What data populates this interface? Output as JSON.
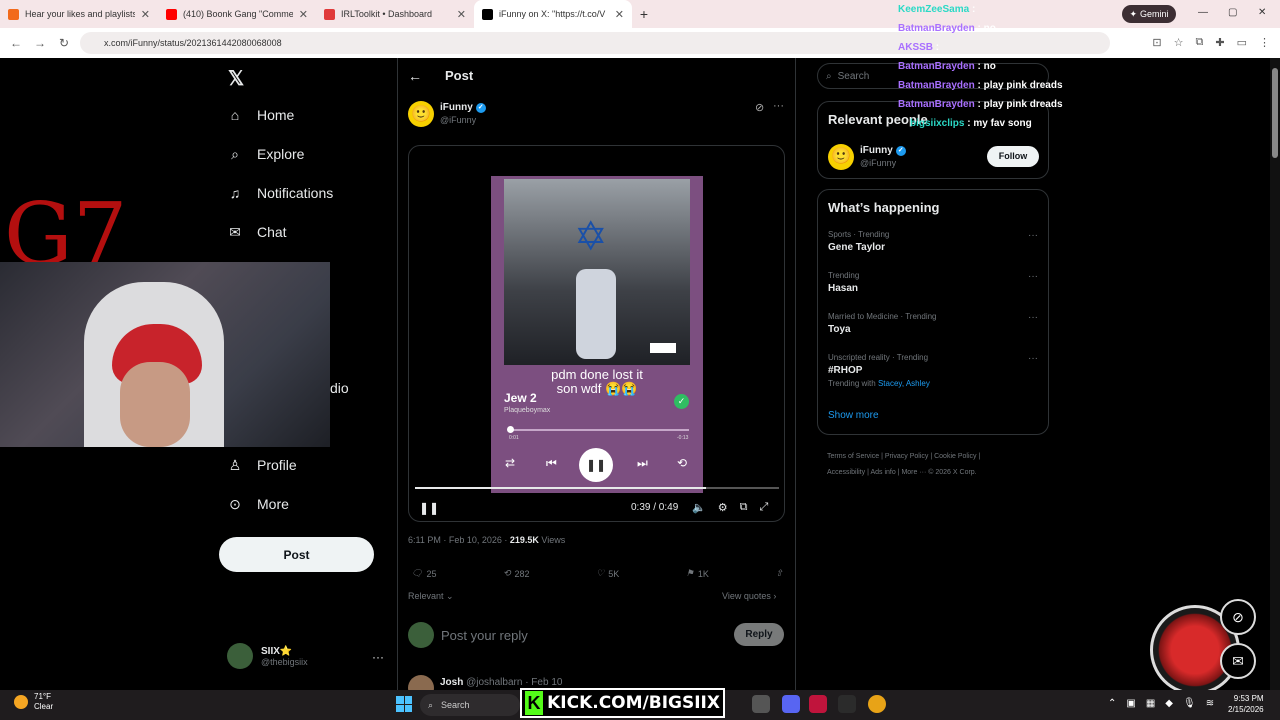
{
  "browser": {
    "tabs": [
      {
        "title": "Hear your likes and playlists, an",
        "color": "#f26a1b"
      },
      {
        "title": "(410) Boonk Gang \"Comments",
        "color": "#ff0000"
      },
      {
        "title": "IRLToolkit • Dashboard",
        "color": "#e03a3a"
      },
      {
        "title": "iFunny on X: \"https://t.co/V",
        "color": "#000000"
      }
    ],
    "url": "x.com/iFunny/status/2021361442080068008",
    "gemini_label": "Gemini"
  },
  "nav": {
    "items": [
      {
        "label": "Home",
        "icon": "home-icon"
      },
      {
        "label": "Explore",
        "icon": "search-icon"
      },
      {
        "label": "Notifications",
        "icon": "bell-icon"
      },
      {
        "label": "Chat",
        "icon": "mail-icon"
      },
      {
        "label": "Profile",
        "icon": "person-icon"
      },
      {
        "label": "More",
        "icon": "more-circle-icon"
      }
    ],
    "partial_label": "dio",
    "post_button": "Post",
    "account": {
      "name": "SIIX⭐",
      "handle": "@thebigsiix"
    }
  },
  "overlay": {
    "g7": "G7"
  },
  "post": {
    "header": "Post",
    "author": {
      "name": "iFunny",
      "handle": "@iFunny"
    },
    "video": {
      "caption_line1": "pdm done lost it",
      "caption_line2": "son wdf 😭😭",
      "song": "Jew 2",
      "artist": "Plaqueboymax",
      "elapsed_small": "0:01",
      "remaining_small": "-0:13",
      "time": "0:39 / 0:49",
      "progress": 0.8
    },
    "meta": {
      "time": "6:11 PM · Feb 10, 2026 · ",
      "views": "219.5K",
      "views_label": " Views"
    },
    "actions": {
      "replies": "25",
      "reposts": "282",
      "likes": "5K",
      "bookmarks": "1K"
    },
    "relevant": "Relevant ⌄",
    "view_quotes": "View quotes ›",
    "reply_placeholder": "Post your reply",
    "reply_button": "Reply",
    "next_reply": {
      "name": "Josh",
      "handle": "@joshalbarn · Feb 10"
    }
  },
  "sidebar": {
    "search_placeholder": "Search",
    "relevant_title": "Relevant people",
    "relevant_person": {
      "name": "iFunny",
      "handle": "@iFunny",
      "button": "Follow"
    },
    "happening_title": "What’s happening",
    "trends": [
      {
        "context": "Sports · Trending",
        "name": "Gene Taylor"
      },
      {
        "context": "Trending",
        "name": "Hasan"
      },
      {
        "context": "Married to Medicine · Trending",
        "name": "Toya"
      },
      {
        "context": "Unscripted reality · Trending",
        "name": "#RHOP",
        "with_prefix": "Trending with ",
        "with_names": "Stacey, Ashley"
      }
    ],
    "show_more": "Show more",
    "footer_line1": "Terms of Service  |  Privacy Policy  |  Cookie Policy  |",
    "footer_line2": "Accessibility  |  Ads info  |  More ···  © 2026 X Corp."
  },
  "chat": [
    {
      "user": "KeemZeeSama",
      "message": ":"
    },
    {
      "user": "BatmanBrayden",
      "message": ": no"
    },
    {
      "user": "AKSSB",
      "message": ":"
    },
    {
      "user": "BatmanBrayden",
      "message": ": no"
    },
    {
      "user": "BatmanBrayden",
      "message": ": play pink dreads"
    },
    {
      "user": "BatmanBrayden",
      "message": ": play pink dreads"
    },
    {
      "user": "bigsiixclips",
      "message": ": my fav song"
    }
  ],
  "taskbar": {
    "temp": "71°F",
    "condition": "Clear",
    "search": "Search",
    "kick": "KICK.COM/BIGSIIX",
    "time": "9:53 PM",
    "date": "2/15/2026"
  }
}
